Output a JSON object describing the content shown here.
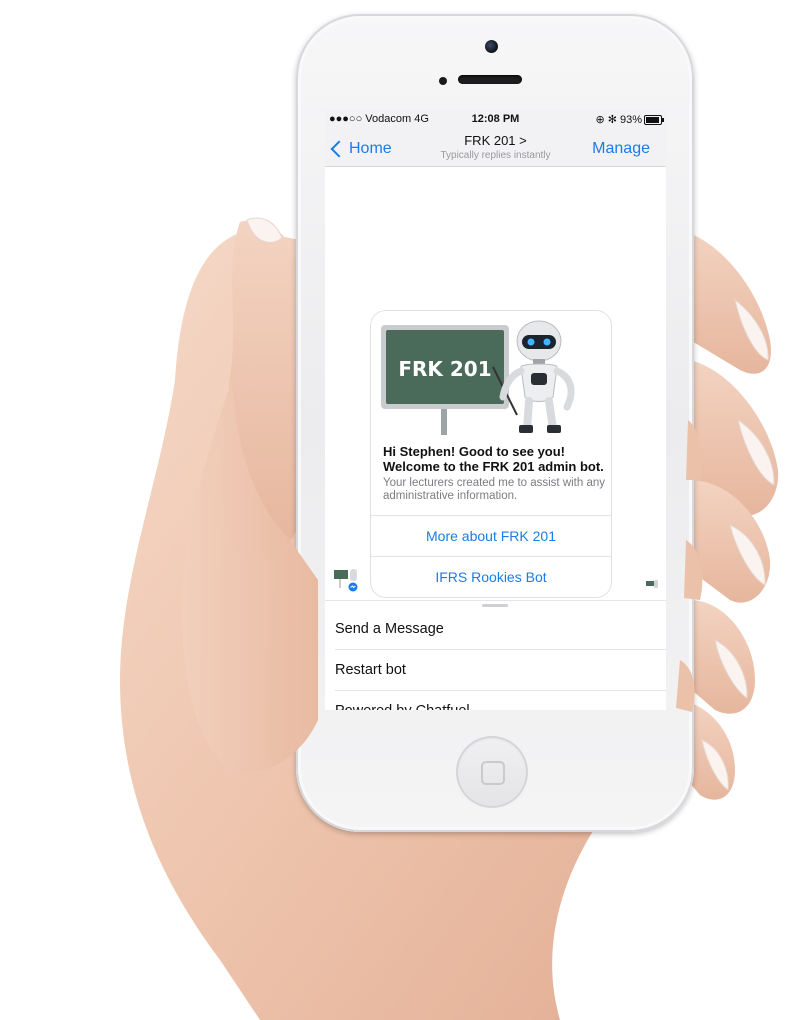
{
  "status_bar": {
    "carrier": "●●●○○ Vodacom  4G",
    "time": "12:08 PM",
    "right": "⊕ ✻ 93%",
    "battery_level": 0.93
  },
  "nav": {
    "back_label": "Home",
    "title": "FRK 201 >",
    "subtitle": "Typically replies instantly",
    "manage_label": "Manage"
  },
  "card": {
    "board_text": "FRK 201",
    "heading": "Hi Stephen! Good to see you! Welcome to the FRK 201 admin bot.",
    "body": "Your lecturers created me to assist with any administrative information.",
    "buttons": [
      {
        "label": "More about FRK 201"
      },
      {
        "label": "IFRS Rookies Bot"
      }
    ]
  },
  "menu": {
    "items": [
      {
        "label": "Send a Message"
      },
      {
        "label": "Restart bot"
      },
      {
        "label": "Powered by Chatfuel"
      }
    ]
  },
  "colors": {
    "accent": "#1a7ce8",
    "board": "#4a6a5a"
  }
}
